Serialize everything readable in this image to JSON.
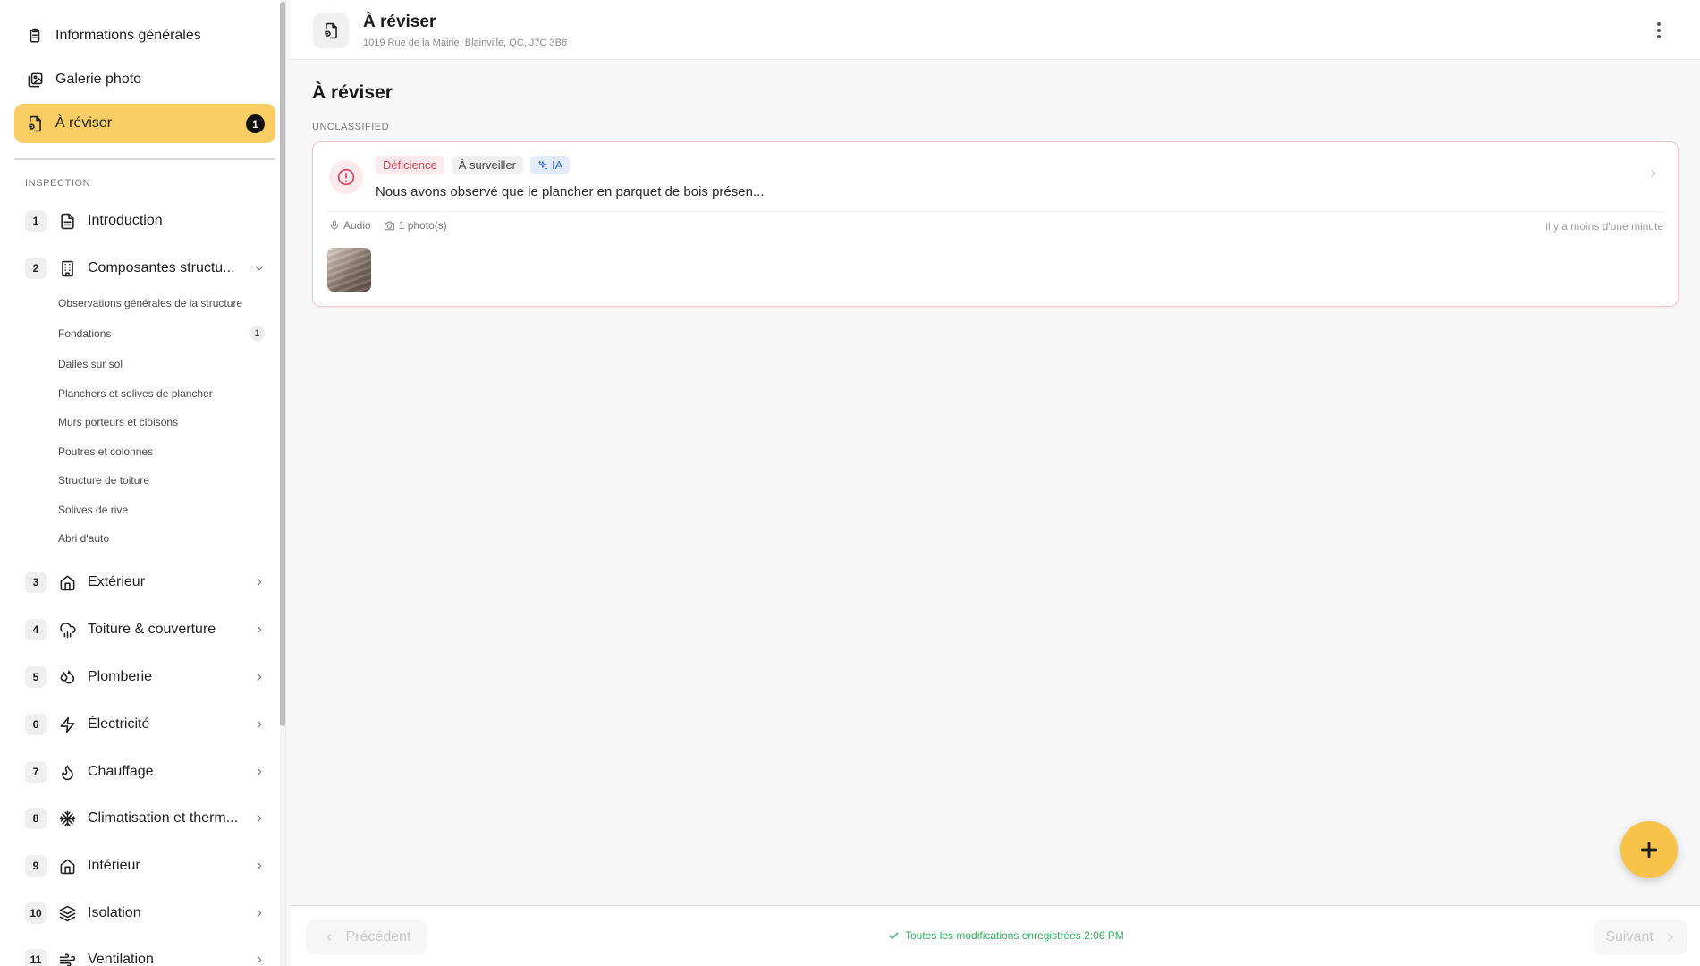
{
  "sidebar": {
    "top_items": [
      {
        "label": "Informations générales",
        "icon": "clipboard-icon"
      },
      {
        "label": "Galerie photo",
        "icon": "gallery-icon"
      },
      {
        "label": "À réviser",
        "icon": "review-icon",
        "badge": "1",
        "active": true
      }
    ],
    "section_label": "INSPECTION",
    "sections": [
      {
        "num": "1",
        "label": "Introduction",
        "icon": "document-icon"
      },
      {
        "num": "2",
        "label": "Composantes structu...",
        "icon": "building-icon",
        "expanded": true
      },
      {
        "num": "3",
        "label": "Extérieur",
        "icon": "house-icon"
      },
      {
        "num": "4",
        "label": "Toiture & couverture",
        "icon": "cloud-rain-icon"
      },
      {
        "num": "5",
        "label": "Plomberie",
        "icon": "droplets-icon"
      },
      {
        "num": "6",
        "label": "Électricité",
        "icon": "zap-icon"
      },
      {
        "num": "7",
        "label": "Chauffage",
        "icon": "flame-icon"
      },
      {
        "num": "8",
        "label": "Climatisation et therm...",
        "icon": "snowflake-icon"
      },
      {
        "num": "9",
        "label": "Intérieur",
        "icon": "house-icon"
      },
      {
        "num": "10",
        "label": "Isolation",
        "icon": "layers-icon"
      },
      {
        "num": "11",
        "label": "Ventilation",
        "icon": "wind-icon"
      }
    ],
    "sub_items": [
      {
        "label": "Observations générales de la structure"
      },
      {
        "label": "Fondations",
        "badge": "1"
      },
      {
        "label": "Dalles sur sol"
      },
      {
        "label": "Planchers et solives de plancher"
      },
      {
        "label": "Murs porteurs et cloisons"
      },
      {
        "label": "Poutres et colonnes"
      },
      {
        "label": "Structure de toiture"
      },
      {
        "label": "Solives de rive"
      },
      {
        "label": "Abri d'auto"
      }
    ]
  },
  "header": {
    "title": "À réviser",
    "address": "1019 Rue de la Mairie, Blainville, QC, J7C 3B6"
  },
  "main": {
    "title": "À réviser",
    "group_label": "UNCLASSIFIED",
    "card": {
      "tags": {
        "deficiency": "Déficience",
        "watch": "À surveiller",
        "ai": "IA"
      },
      "text": "Nous avons observé que le plancher en parquet de bois présen...",
      "audio_label": "Audio",
      "photos_label": "1 photo(s)",
      "time": "il y a moins d'une minute"
    }
  },
  "footer": {
    "prev_label": "Précédent",
    "next_label": "Suivant",
    "status": "Toutes les modifications enregistrées 2:06 PM"
  },
  "colors": {
    "accent": "#f8cd63",
    "deficiency": "#d64556",
    "ai": "#3d6fd6",
    "success": "#2fae5a"
  }
}
